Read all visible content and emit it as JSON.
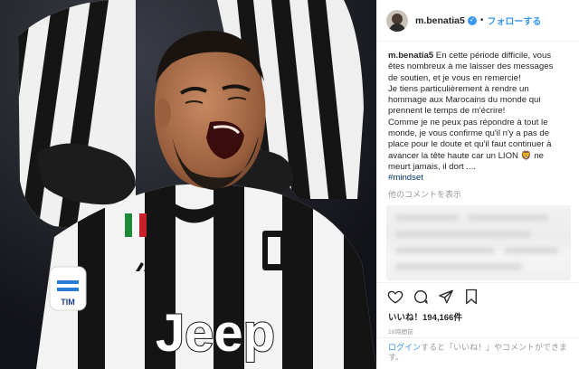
{
  "post": {
    "username": "m.benatia5",
    "follow_label": "フォローする",
    "separator": "•",
    "caption_user": "m.benatia5",
    "caption_lines": [
      "En cette période difficile, vous",
      "êtes nombreux à me laisser des messages",
      "de soutien, et je vous en remercie!",
      "Je tiens particulièrement à rendre un",
      "hommage aux Marocains du monde qui",
      "prennent le temps de m'écrire!",
      "Comme je ne peux pas répondre à tout le",
      "monde, je vous confirme qu'il n'y a pas de",
      "place pour le doute et qu'il faut continuer à",
      "avancer la tête haute car un LION 🦁 ne",
      "meurt jamais, il dort ...."
    ],
    "hashtag": "#mindset",
    "more_comments": "他のコメントを表示",
    "likes": "いいね！194,166件",
    "timestamp": "18時間前",
    "login_link": "ログイン",
    "login_text": "すると「いいね！」やコメントができます。"
  },
  "photo": {
    "jersey_brand": "Jeep",
    "jersey_badge": "TIM",
    "colors": {
      "black": "#141414",
      "white": "#f2f2f2",
      "background": "#1b1c21"
    }
  },
  "icons": {
    "verified": "verified-badge-icon",
    "like": "heart-icon",
    "comment": "comment-icon",
    "share": "share-icon",
    "save": "bookmark-icon"
  },
  "colors": {
    "link": "#3897f0",
    "text": "#262626",
    "muted": "#999999",
    "hashtag": "#003569"
  }
}
